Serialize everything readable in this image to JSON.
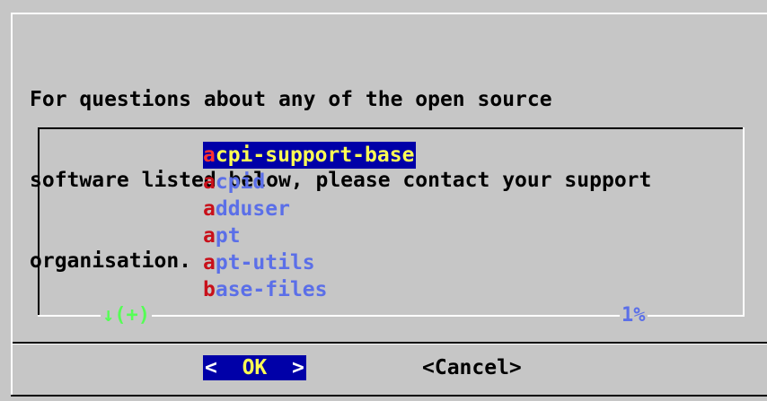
{
  "message": {
    "lines": [
      "For questions about any of the open source",
      "software listed below, please contact your support",
      "organisation."
    ]
  },
  "list": {
    "items": [
      {
        "hotkey": "a",
        "rest": "cpi-support-base",
        "selected": true
      },
      {
        "hotkey": "a",
        "rest": "cpid",
        "selected": false
      },
      {
        "hotkey": "a",
        "rest": "dduser",
        "selected": false
      },
      {
        "hotkey": "a",
        "rest": "pt",
        "selected": false
      },
      {
        "hotkey": "a",
        "rest": "pt-utils",
        "selected": false
      },
      {
        "hotkey": "b",
        "rest": "ase-files",
        "selected": false
      }
    ],
    "scroll_indicator": "↓(+)",
    "percent": "1%"
  },
  "buttons": {
    "ok_left": "<",
    "ok_label": "OK",
    "ok_right": ">",
    "cancel_label": "<Cancel>"
  },
  "colors": {
    "background": "#c6c6c6",
    "selection_bg": "#0000a8",
    "selection_fg": "#ffff54",
    "hotkey": "#c8101a",
    "item": "#5b6fe8",
    "indicator": "#55ff55"
  }
}
